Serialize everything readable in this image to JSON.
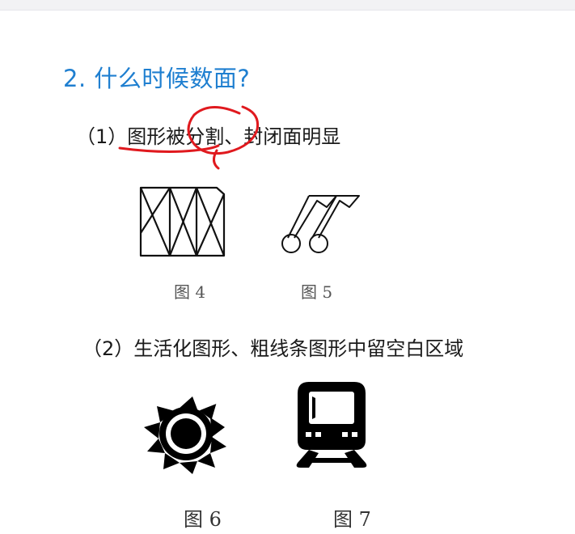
{
  "heading": "2. 什么时候数面?",
  "items": [
    "（1）图形被分割、封闭面明显",
    "（2）生活化图形、粗线条图形中留空白区域"
  ],
  "figures": {
    "fig4": "图 4",
    "fig5": "图 5",
    "fig6": "图 6",
    "fig7": "图 7"
  },
  "colors": {
    "heading": "#1f7fd0",
    "annotation": "#e0191e"
  },
  "icons": [
    "divided-square-figure",
    "musical-note-figure",
    "sun-icon",
    "train-icon"
  ]
}
